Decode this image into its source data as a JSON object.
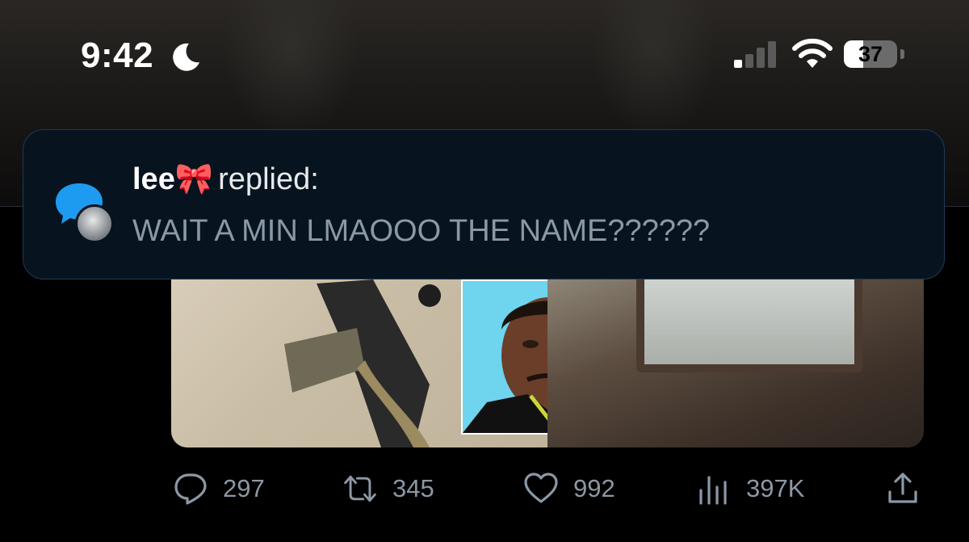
{
  "status_bar": {
    "time": "9:42",
    "battery_level": "37",
    "battery_fraction": 0.37,
    "icons": [
      "moon-icon",
      "cellular-signal-icon",
      "wifi-icon",
      "battery-icon"
    ]
  },
  "notification": {
    "user": "lee🎀",
    "action": "replied:",
    "message": "WAIT A MIN LMAOOO THE NAME??????",
    "icons": [
      "reply-bubble-icon",
      "avatar"
    ]
  },
  "tweet": {
    "actions": [
      {
        "name": "reply",
        "icon": "reply-icon",
        "count": "297"
      },
      {
        "name": "retweet",
        "icon": "retweet-icon",
        "count": "345"
      },
      {
        "name": "like",
        "icon": "heart-icon",
        "count": "992"
      },
      {
        "name": "views",
        "icon": "analytics-icon",
        "count": "397K"
      },
      {
        "name": "share",
        "icon": "share-icon",
        "count": ""
      }
    ]
  },
  "colors": {
    "notification_bg": "#07141f",
    "notification_border": "#1f3a55",
    "accent_blue": "#1d9bf0",
    "muted_text": "#8b98a5"
  }
}
